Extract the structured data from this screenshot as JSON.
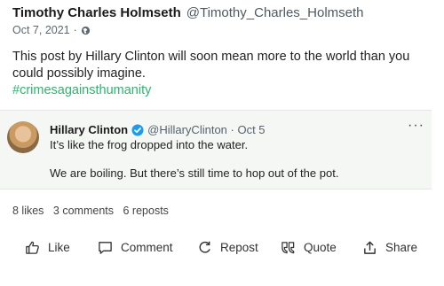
{
  "post": {
    "author_name": "Timothy Charles Holmseth",
    "author_handle": "@Timothy_Charles_Holmseth",
    "date": "Oct 7, 2021",
    "visibility_icon": "globe-icon",
    "text": "This post by Hillary Clinton will soon mean more to the world than you could possibly imagine.",
    "hashtag": "#crimesagainsthumanity"
  },
  "quoted": {
    "name": "Hillary Clinton",
    "handle": "@HillaryClinton · Oct 5",
    "line1": "It’s like the frog dropped into the water.",
    "line2": "We are boiling. But there’s still time to hop out of the pot.",
    "more": "···"
  },
  "stats": {
    "likes": "8 likes",
    "comments": "3 comments",
    "reposts": "6 reposts"
  },
  "actions": {
    "like": "Like",
    "comment": "Comment",
    "repost": "Repost",
    "quote": "Quote",
    "share": "Share"
  },
  "colors": {
    "hashtag": "#2fb46e",
    "verified": "#1d9bf0",
    "quote_bg": "#f5f7f5"
  }
}
